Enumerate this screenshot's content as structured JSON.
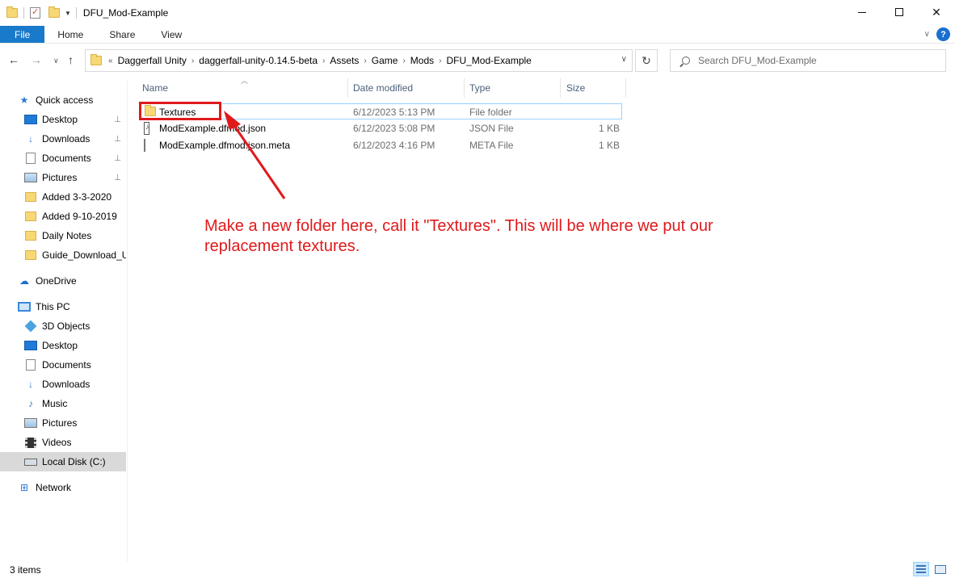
{
  "window": {
    "title": "DFU_Mod-Example",
    "controls": {
      "minimize": "—",
      "maximize": "□",
      "close": "✕"
    }
  },
  "ribbon": {
    "tabs": [
      "File",
      "Home",
      "Share",
      "View"
    ],
    "help": "?"
  },
  "nav": {
    "breadcrumb_overflow": "«",
    "breadcrumb": [
      "Daggerfall Unity",
      "daggerfall-unity-0.14.5-beta",
      "Assets",
      "Game",
      "Mods",
      "DFU_Mod-Example"
    ],
    "search_placeholder": "Search DFU_Mod-Example"
  },
  "sidebar": {
    "items": [
      {
        "label": "Quick access",
        "icon": "star-icon"
      },
      {
        "label": "Desktop",
        "icon": "desktop-icon",
        "pinned": true
      },
      {
        "label": "Downloads",
        "icon": "download-arrow-icon",
        "pinned": true
      },
      {
        "label": "Documents",
        "icon": "document-icon",
        "pinned": true
      },
      {
        "label": "Pictures",
        "icon": "pictures-icon",
        "pinned": true
      },
      {
        "label": "Added 3-3-2020",
        "icon": "folder-icon"
      },
      {
        "label": "Added 9-10-2019",
        "icon": "folder-icon"
      },
      {
        "label": "Daily Notes",
        "icon": "folder-icon"
      },
      {
        "label": "Guide_Download_U",
        "icon": "folder-icon"
      },
      {
        "label": "OneDrive",
        "icon": "cloud-icon"
      },
      {
        "label": "This PC",
        "icon": "computer-icon"
      },
      {
        "label": "3D Objects",
        "icon": "cube-icon"
      },
      {
        "label": "Desktop",
        "icon": "desktop-icon"
      },
      {
        "label": "Documents",
        "icon": "document-icon"
      },
      {
        "label": "Downloads",
        "icon": "download-arrow-icon"
      },
      {
        "label": "Music",
        "icon": "music-note-icon"
      },
      {
        "label": "Pictures",
        "icon": "pictures-icon"
      },
      {
        "label": "Videos",
        "icon": "film-icon"
      },
      {
        "label": "Local Disk (C:)",
        "icon": "disk-drive-icon",
        "selected": true
      },
      {
        "label": "Network",
        "icon": "network-icon"
      }
    ],
    "pin_glyph": "📌"
  },
  "file_list": {
    "columns": [
      "Name",
      "Date modified",
      "Type",
      "Size"
    ],
    "rows": [
      {
        "name": "Textures",
        "date": "6/12/2023 5:13 PM",
        "type": "File folder",
        "size": "",
        "icon": "folder-icon",
        "selected": true
      },
      {
        "name": "ModExample.dfmod.json",
        "date": "6/12/2023 5:08 PM",
        "type": "JSON File",
        "size": "1 KB",
        "icon": "json-file-icon"
      },
      {
        "name": "ModExample.dfmod.json.meta",
        "date": "6/12/2023 4:16 PM",
        "type": "META File",
        "size": "1 KB",
        "icon": "blank-file-icon"
      }
    ]
  },
  "annotation": {
    "text": "Make a new folder here, call it \"Textures\". This will be where we put our replacement textures.",
    "color": "#e0191b"
  },
  "status": {
    "item_count": "3 items"
  },
  "colors": {
    "accent": "#1979ca",
    "selection_border": "#99d1ff",
    "header_text": "#4c607a"
  }
}
